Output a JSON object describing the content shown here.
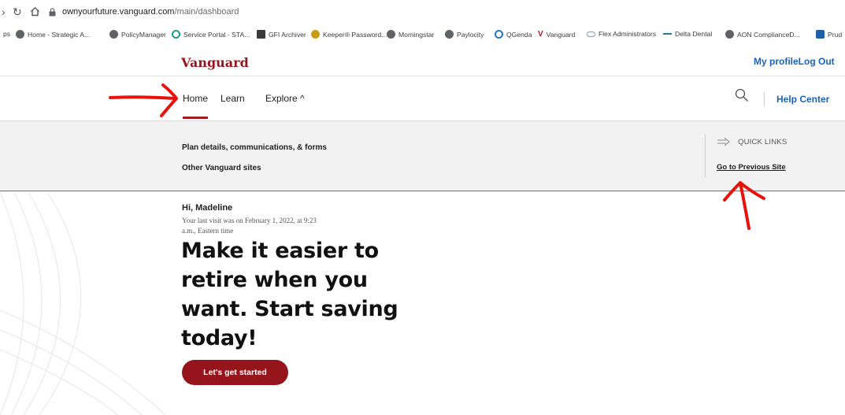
{
  "browser": {
    "url_host": "ownyourfuture.vanguard.com",
    "url_path": "/main/dashboard",
    "bookmarks": [
      {
        "label": "ps",
        "icon": "none"
      },
      {
        "label": "Home - Strategic A...",
        "icon": "globe-icon"
      },
      {
        "label": "PolicyManager",
        "icon": "globe-icon"
      },
      {
        "label": "Service Portal - STA...",
        "icon": "service-portal-icon"
      },
      {
        "label": "GFI Archiver",
        "icon": "archiver-icon"
      },
      {
        "label": "Keeper® Password...",
        "icon": "keeper-icon"
      },
      {
        "label": "Morningstar",
        "icon": "globe-icon"
      },
      {
        "label": "Paylocity",
        "icon": "globe-icon"
      },
      {
        "label": "QGenda",
        "icon": "qgenda-icon"
      },
      {
        "label": "Vanguard",
        "icon": "vanguard-icon"
      },
      {
        "label": "Flex Administrators",
        "icon": "cloud-icon"
      },
      {
        "label": "Delta Dental",
        "icon": "dash-icon"
      },
      {
        "label": "AON ComplianceD...",
        "icon": "globe-icon"
      },
      {
        "label": "Prud",
        "icon": "prudential-icon"
      }
    ]
  },
  "header": {
    "logo": "Vanguard",
    "my_profile": "My profileLog Out"
  },
  "nav": {
    "home": "Home",
    "learn": "Learn",
    "explore": "Explore ^",
    "help_center": "Help Center"
  },
  "mega": {
    "plan_details": "Plan details, communications, & forms",
    "other_sites": "Other Vanguard sites",
    "quick_links": "QUICK LINKS",
    "previous_site": "Go to Previous Site"
  },
  "hero": {
    "greeting": "Hi, Madeline",
    "last_visit": "Your last visit was on February 1, 2022, at 9:23 a.m., Eastern time",
    "title": "Make it easier to retire when you want. Start saving today!",
    "cta": "Let's get started"
  },
  "colors": {
    "brand": "#96151d",
    "link": "#1a62b8",
    "annotation": "#e8120c"
  }
}
